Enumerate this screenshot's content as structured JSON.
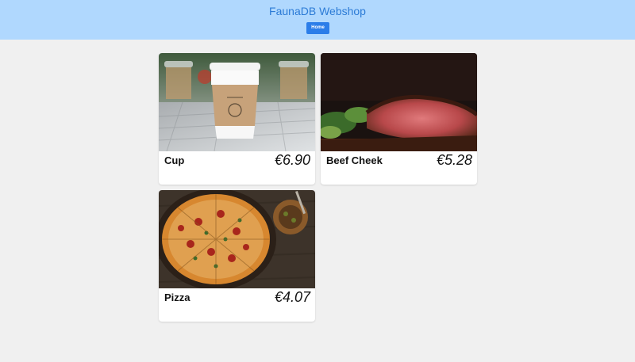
{
  "header": {
    "title": "FaunaDB Webshop",
    "home_label": "Home",
    "background_color": "#b0d8fe",
    "title_color": "#2c7bd6",
    "button_color": "#2b7de9"
  },
  "products": [
    {
      "name": "Cup",
      "price": "€6.90",
      "image": "coffee-cup-photo"
    },
    {
      "name": "Beef Cheek",
      "price": "€5.28",
      "image": "beef-steak-photo"
    },
    {
      "name": "Pizza",
      "price": "€4.07",
      "image": "pizza-photo"
    }
  ]
}
